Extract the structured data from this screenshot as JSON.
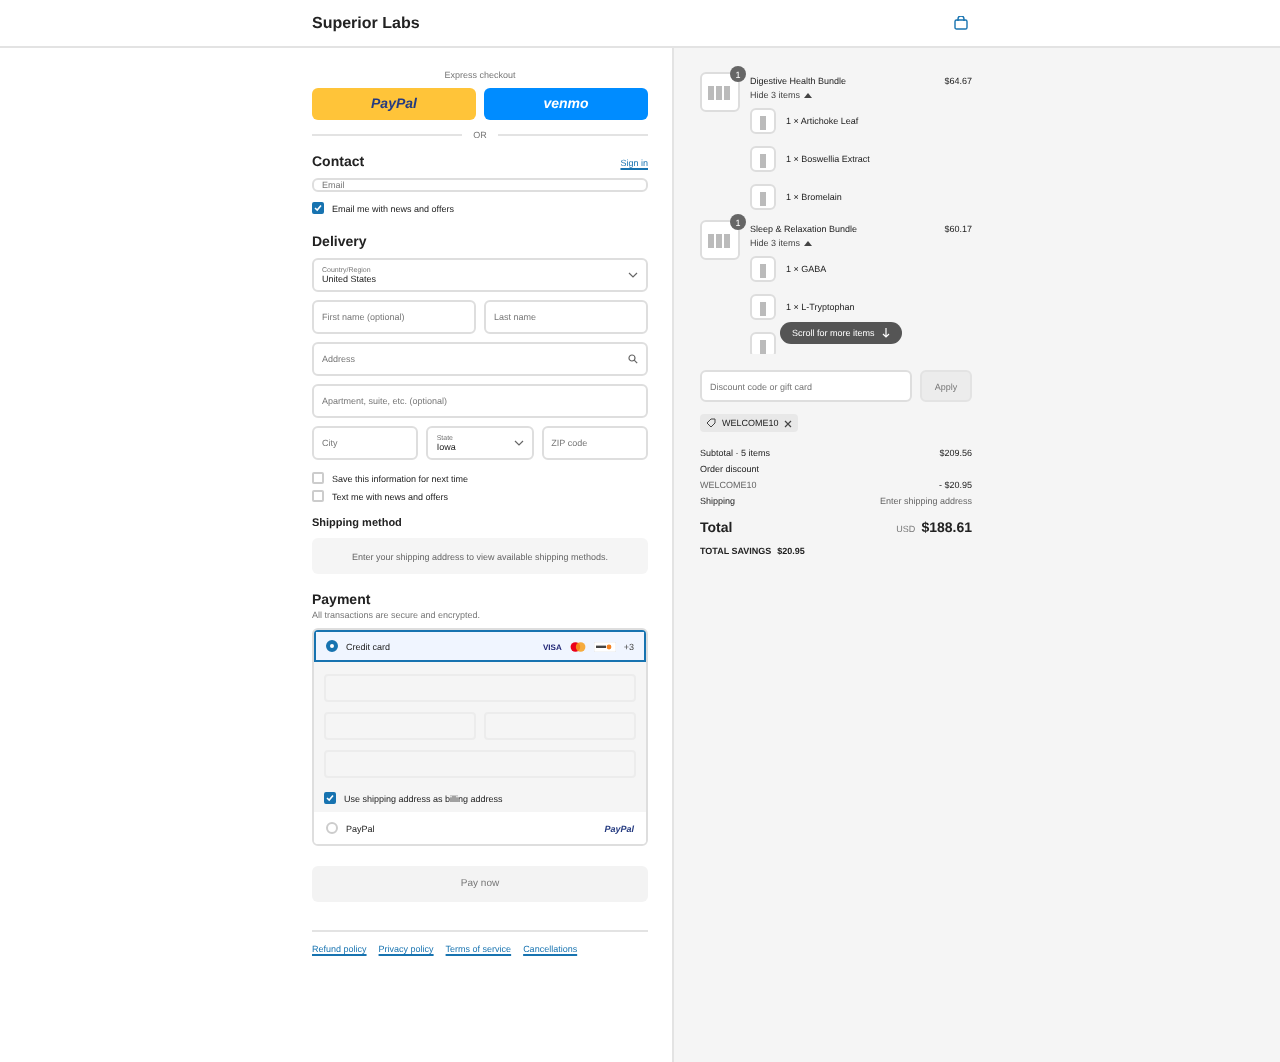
{
  "header": {
    "brand": "Superior Labs"
  },
  "express": {
    "label": "Express checkout",
    "paypal": "PayPal",
    "venmo": "venmo",
    "or": "OR"
  },
  "contact": {
    "title": "Contact",
    "sign_in": "Sign in",
    "email_placeholder": "Email",
    "news": {
      "label": "Email me with news and offers",
      "checked": true
    }
  },
  "delivery": {
    "title": "Delivery",
    "rows": [
      [
        {
          "kind": "select",
          "label": "Country/Region",
          "value": "United States"
        }
      ],
      [
        {
          "kind": "input",
          "placeholder": "First name (optional)"
        },
        {
          "kind": "input",
          "placeholder": "Last name"
        }
      ],
      [
        {
          "kind": "search",
          "placeholder": "Address"
        }
      ],
      [
        {
          "kind": "input",
          "placeholder": "Apartment, suite, etc. (optional)"
        }
      ],
      [
        {
          "kind": "input",
          "placeholder": "City"
        },
        {
          "kind": "select",
          "label": "State",
          "value": "Iowa"
        },
        {
          "kind": "input",
          "placeholder": "ZIP code"
        }
      ]
    ],
    "checks": [
      {
        "label": "Save this information for next time",
        "checked": false
      },
      {
        "label": "Text me with news and offers",
        "checked": false
      }
    ]
  },
  "shipping": {
    "title": "Shipping method",
    "message": "Enter your shipping address to view available shipping methods."
  },
  "payment": {
    "title": "Payment",
    "subtitle": "All transactions are secure and encrypted.",
    "methods": [
      {
        "kind": "card",
        "label": "Credit card",
        "selected": true,
        "visa": "VISA",
        "more": "+3"
      },
      {
        "kind": "paypal",
        "label": "PayPal",
        "selected": false,
        "logo": "PayPal"
      }
    ],
    "billing": {
      "label": "Use shipping address as billing address",
      "checked": true
    }
  },
  "pay_button": "Pay now",
  "footer_links": [
    "Refund policy",
    "Privacy policy",
    "Terms of service",
    "Cancellations"
  ],
  "summary": {
    "items": [
      {
        "quantity": "1",
        "name": "Digestive Health Bundle",
        "price": "$64.67",
        "toggle": "Hide 3 items",
        "children": [
          {
            "kind": "line",
            "label": "1 × Artichoke Leaf"
          },
          {
            "kind": "line",
            "label": "1 × Boswellia Extract"
          },
          {
            "kind": "line",
            "label": "1 × Bromelain"
          }
        ]
      },
      {
        "quantity": "1",
        "name": "Sleep & Relaxation Bundle",
        "price": "$60.17",
        "toggle": "Hide 3 items",
        "children": [
          {
            "kind": "line",
            "label": "1 × GABA"
          },
          {
            "kind": "line",
            "label": "1 × L-Tryptophan"
          },
          {
            "kind": "thumb"
          }
        ]
      }
    ],
    "scroll_hint": "Scroll for more items",
    "discount_placeholder": "Discount code or gift card",
    "apply": "Apply",
    "applied_code": "WELCOME10",
    "subtotal_label": "Subtotal · 5 items",
    "subtotal": "$209.56",
    "discount_label": "Order discount",
    "discount_code": "WELCOME10",
    "discount_amount": "- $20.95",
    "shipping_label": "Shipping",
    "shipping_value": "Enter shipping address",
    "total_label": "Total",
    "currency": "USD",
    "total": "$188.61",
    "savings_label": "TOTAL SAVINGS",
    "savings": "$20.95"
  }
}
